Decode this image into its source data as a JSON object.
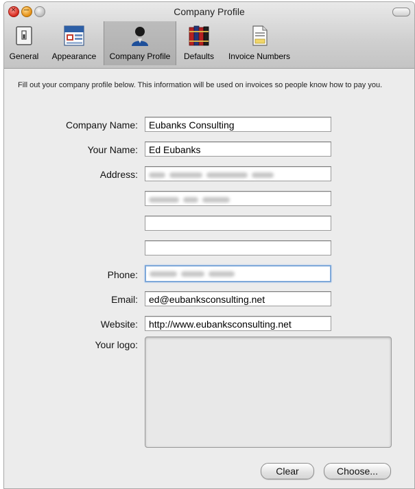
{
  "window": {
    "title": "Company Profile"
  },
  "toolbar": {
    "tabs": [
      {
        "label": "General",
        "icon": "switch-icon"
      },
      {
        "label": "Appearance",
        "icon": "appearance-icon"
      },
      {
        "label": "Company Profile",
        "icon": "person-icon",
        "active": true
      },
      {
        "label": "Defaults",
        "icon": "books-icon"
      },
      {
        "label": "Invoice Numbers",
        "icon": "document-icon"
      }
    ]
  },
  "intro_text": "Fill out your company profile below. This information will be used on invoices so people know how to pay you.",
  "form": {
    "company_name_label": "Company Name:",
    "company_name_value": "Eubanks Consulting",
    "your_name_label": "Your Name:",
    "your_name_value": "Ed Eubanks",
    "address_label": "Address:",
    "phone_label": "Phone:",
    "email_label": "Email:",
    "email_value": "ed@eubanksconsulting.net",
    "website_label": "Website:",
    "website_value": "http://www.eubanksconsulting.net",
    "logo_label": "Your logo:"
  },
  "buttons": {
    "clear_label": "Clear",
    "choose_label": "Choose..."
  },
  "colors": {
    "window_bg": "#ececec",
    "focus_ring": "#7ea8d9",
    "active_tab": "#b4b4b4"
  }
}
